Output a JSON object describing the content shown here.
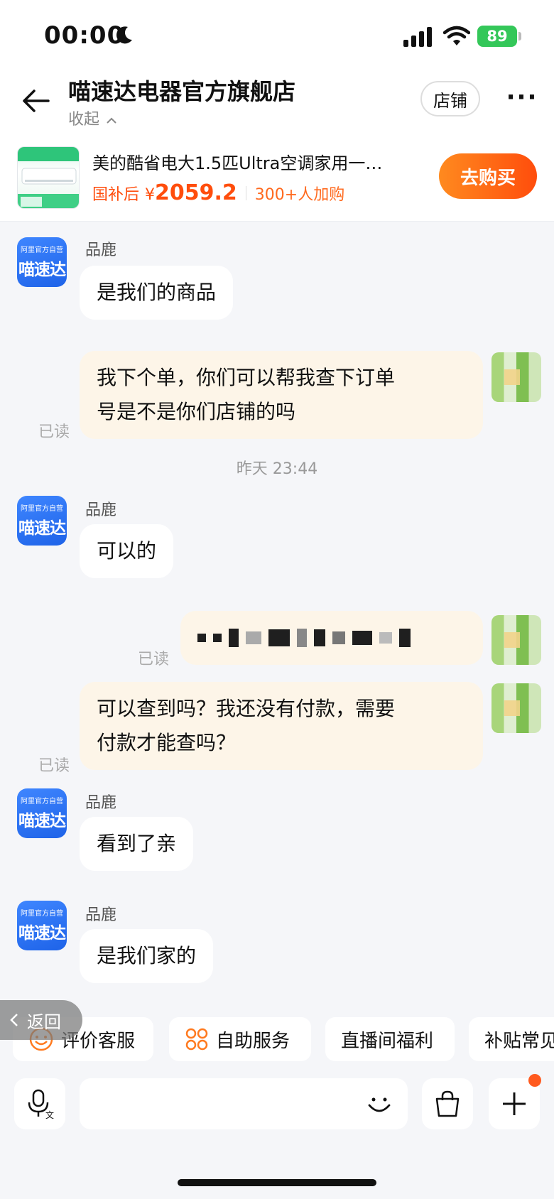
{
  "status_bar": {
    "time": "00:00",
    "battery": "89"
  },
  "header": {
    "shop_name": "喵速达电器官方旗舰店",
    "collapse_label": "收起",
    "store_button": "店铺"
  },
  "product": {
    "title": "美的酷省电大1.5匹Ultra空调家用一…",
    "price_label": "国补后",
    "currency": "¥",
    "price": "2059.2",
    "buyers": "300+人加购",
    "buy_button": "去购买"
  },
  "shop_avatar": {
    "top_text": "阿里官方自营",
    "main_text": "喵速达"
  },
  "messages": {
    "m1": {
      "sender": "品鹿",
      "text": "是我们的商品"
    },
    "m2": {
      "line1": "我下个单，你们可以帮我查下订单",
      "line2": "号是不是你们店铺的吗",
      "read": "已读"
    },
    "time1": "昨天 23:44",
    "m3": {
      "sender": "品鹿",
      "text": "可以的"
    },
    "m4": {
      "read": "已读"
    },
    "m5": {
      "line1": "可以查到吗？我还没有付款，需要",
      "line2": "付款才能查吗？",
      "read": "已读"
    },
    "m6": {
      "sender": "品鹿",
      "text": "看到了亲"
    },
    "m7": {
      "sender": "品鹿",
      "text": "是我们家的"
    }
  },
  "back_pill": {
    "label": "返回"
  },
  "quick_actions": [
    "评价客服",
    "自助服务",
    "直播间福利",
    "补贴常见"
  ],
  "colors": {
    "accent": "#ff4d0c",
    "shop_blue": "#1e63e8",
    "out_bubble": "#fdf5e8"
  }
}
